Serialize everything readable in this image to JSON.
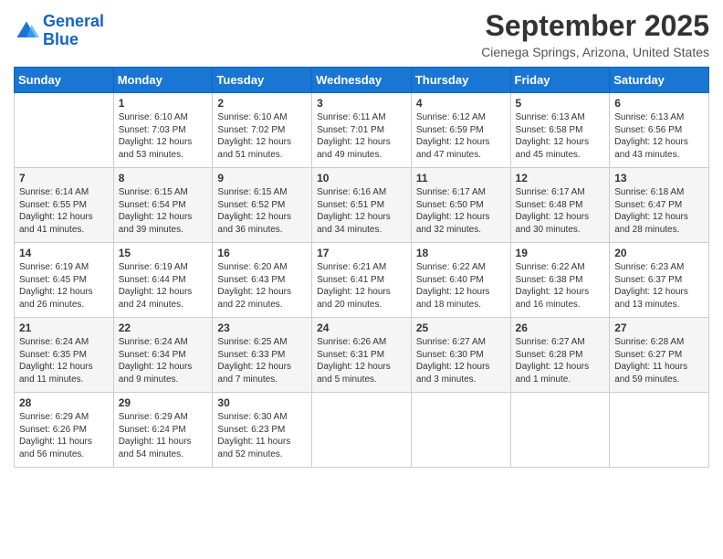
{
  "header": {
    "logo_line1": "General",
    "logo_line2": "Blue",
    "month": "September 2025",
    "location": "Cienega Springs, Arizona, United States"
  },
  "weekdays": [
    "Sunday",
    "Monday",
    "Tuesday",
    "Wednesday",
    "Thursday",
    "Friday",
    "Saturday"
  ],
  "weeks": [
    [
      {
        "day": "",
        "sunrise": "",
        "sunset": "",
        "daylight": ""
      },
      {
        "day": "1",
        "sunrise": "Sunrise: 6:10 AM",
        "sunset": "Sunset: 7:03 PM",
        "daylight": "Daylight: 12 hours and 53 minutes."
      },
      {
        "day": "2",
        "sunrise": "Sunrise: 6:10 AM",
        "sunset": "Sunset: 7:02 PM",
        "daylight": "Daylight: 12 hours and 51 minutes."
      },
      {
        "day": "3",
        "sunrise": "Sunrise: 6:11 AM",
        "sunset": "Sunset: 7:01 PM",
        "daylight": "Daylight: 12 hours and 49 minutes."
      },
      {
        "day": "4",
        "sunrise": "Sunrise: 6:12 AM",
        "sunset": "Sunset: 6:59 PM",
        "daylight": "Daylight: 12 hours and 47 minutes."
      },
      {
        "day": "5",
        "sunrise": "Sunrise: 6:13 AM",
        "sunset": "Sunset: 6:58 PM",
        "daylight": "Daylight: 12 hours and 45 minutes."
      },
      {
        "day": "6",
        "sunrise": "Sunrise: 6:13 AM",
        "sunset": "Sunset: 6:56 PM",
        "daylight": "Daylight: 12 hours and 43 minutes."
      }
    ],
    [
      {
        "day": "7",
        "sunrise": "Sunrise: 6:14 AM",
        "sunset": "Sunset: 6:55 PM",
        "daylight": "Daylight: 12 hours and 41 minutes."
      },
      {
        "day": "8",
        "sunrise": "Sunrise: 6:15 AM",
        "sunset": "Sunset: 6:54 PM",
        "daylight": "Daylight: 12 hours and 39 minutes."
      },
      {
        "day": "9",
        "sunrise": "Sunrise: 6:15 AM",
        "sunset": "Sunset: 6:52 PM",
        "daylight": "Daylight: 12 hours and 36 minutes."
      },
      {
        "day": "10",
        "sunrise": "Sunrise: 6:16 AM",
        "sunset": "Sunset: 6:51 PM",
        "daylight": "Daylight: 12 hours and 34 minutes."
      },
      {
        "day": "11",
        "sunrise": "Sunrise: 6:17 AM",
        "sunset": "Sunset: 6:50 PM",
        "daylight": "Daylight: 12 hours and 32 minutes."
      },
      {
        "day": "12",
        "sunrise": "Sunrise: 6:17 AM",
        "sunset": "Sunset: 6:48 PM",
        "daylight": "Daylight: 12 hours and 30 minutes."
      },
      {
        "day": "13",
        "sunrise": "Sunrise: 6:18 AM",
        "sunset": "Sunset: 6:47 PM",
        "daylight": "Daylight: 12 hours and 28 minutes."
      }
    ],
    [
      {
        "day": "14",
        "sunrise": "Sunrise: 6:19 AM",
        "sunset": "Sunset: 6:45 PM",
        "daylight": "Daylight: 12 hours and 26 minutes."
      },
      {
        "day": "15",
        "sunrise": "Sunrise: 6:19 AM",
        "sunset": "Sunset: 6:44 PM",
        "daylight": "Daylight: 12 hours and 24 minutes."
      },
      {
        "day": "16",
        "sunrise": "Sunrise: 6:20 AM",
        "sunset": "Sunset: 6:43 PM",
        "daylight": "Daylight: 12 hours and 22 minutes."
      },
      {
        "day": "17",
        "sunrise": "Sunrise: 6:21 AM",
        "sunset": "Sunset: 6:41 PM",
        "daylight": "Daylight: 12 hours and 20 minutes."
      },
      {
        "day": "18",
        "sunrise": "Sunrise: 6:22 AM",
        "sunset": "Sunset: 6:40 PM",
        "daylight": "Daylight: 12 hours and 18 minutes."
      },
      {
        "day": "19",
        "sunrise": "Sunrise: 6:22 AM",
        "sunset": "Sunset: 6:38 PM",
        "daylight": "Daylight: 12 hours and 16 minutes."
      },
      {
        "day": "20",
        "sunrise": "Sunrise: 6:23 AM",
        "sunset": "Sunset: 6:37 PM",
        "daylight": "Daylight: 12 hours and 13 minutes."
      }
    ],
    [
      {
        "day": "21",
        "sunrise": "Sunrise: 6:24 AM",
        "sunset": "Sunset: 6:35 PM",
        "daylight": "Daylight: 12 hours and 11 minutes."
      },
      {
        "day": "22",
        "sunrise": "Sunrise: 6:24 AM",
        "sunset": "Sunset: 6:34 PM",
        "daylight": "Daylight: 12 hours and 9 minutes."
      },
      {
        "day": "23",
        "sunrise": "Sunrise: 6:25 AM",
        "sunset": "Sunset: 6:33 PM",
        "daylight": "Daylight: 12 hours and 7 minutes."
      },
      {
        "day": "24",
        "sunrise": "Sunrise: 6:26 AM",
        "sunset": "Sunset: 6:31 PM",
        "daylight": "Daylight: 12 hours and 5 minutes."
      },
      {
        "day": "25",
        "sunrise": "Sunrise: 6:27 AM",
        "sunset": "Sunset: 6:30 PM",
        "daylight": "Daylight: 12 hours and 3 minutes."
      },
      {
        "day": "26",
        "sunrise": "Sunrise: 6:27 AM",
        "sunset": "Sunset: 6:28 PM",
        "daylight": "Daylight: 12 hours and 1 minute."
      },
      {
        "day": "27",
        "sunrise": "Sunrise: 6:28 AM",
        "sunset": "Sunset: 6:27 PM",
        "daylight": "Daylight: 11 hours and 59 minutes."
      }
    ],
    [
      {
        "day": "28",
        "sunrise": "Sunrise: 6:29 AM",
        "sunset": "Sunset: 6:26 PM",
        "daylight": "Daylight: 11 hours and 56 minutes."
      },
      {
        "day": "29",
        "sunrise": "Sunrise: 6:29 AM",
        "sunset": "Sunset: 6:24 PM",
        "daylight": "Daylight: 11 hours and 54 minutes."
      },
      {
        "day": "30",
        "sunrise": "Sunrise: 6:30 AM",
        "sunset": "Sunset: 6:23 PM",
        "daylight": "Daylight: 11 hours and 52 minutes."
      },
      {
        "day": "",
        "sunrise": "",
        "sunset": "",
        "daylight": ""
      },
      {
        "day": "",
        "sunrise": "",
        "sunset": "",
        "daylight": ""
      },
      {
        "day": "",
        "sunrise": "",
        "sunset": "",
        "daylight": ""
      },
      {
        "day": "",
        "sunrise": "",
        "sunset": "",
        "daylight": ""
      }
    ]
  ]
}
